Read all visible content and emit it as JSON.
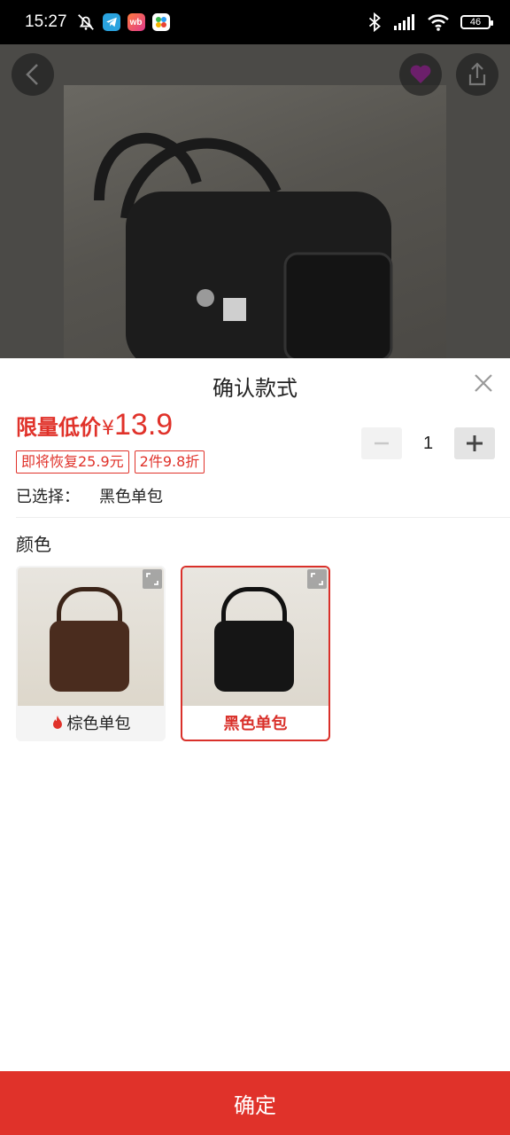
{
  "status_bar": {
    "time": "15:27",
    "battery": "46",
    "icons": [
      "mute-alarm-icon",
      "telegram-icon",
      "weibo-icon",
      "app-icon",
      "bluetooth-icon",
      "signal-icon",
      "wifi-icon",
      "battery-icon"
    ],
    "weibo_label": "wb"
  },
  "sheet": {
    "title": "确认款式",
    "price_label": "限量低价",
    "currency": "¥",
    "price": "13.9",
    "tags": [
      "即将恢复25.9元",
      "2件9.8折"
    ],
    "quantity": "1",
    "selected_prefix": "已选择：",
    "selected_value": "黑色单包",
    "color_section_label": "颜色",
    "options": [
      {
        "label": "棕色单包",
        "hot": true,
        "selected": false
      },
      {
        "label": "黑色单包",
        "hot": false,
        "selected": true
      }
    ],
    "confirm_label": "确定"
  },
  "colors": {
    "accent": "#e0322a",
    "sheet_bg": "#ffffff",
    "status_bar_bg": "#000000"
  }
}
